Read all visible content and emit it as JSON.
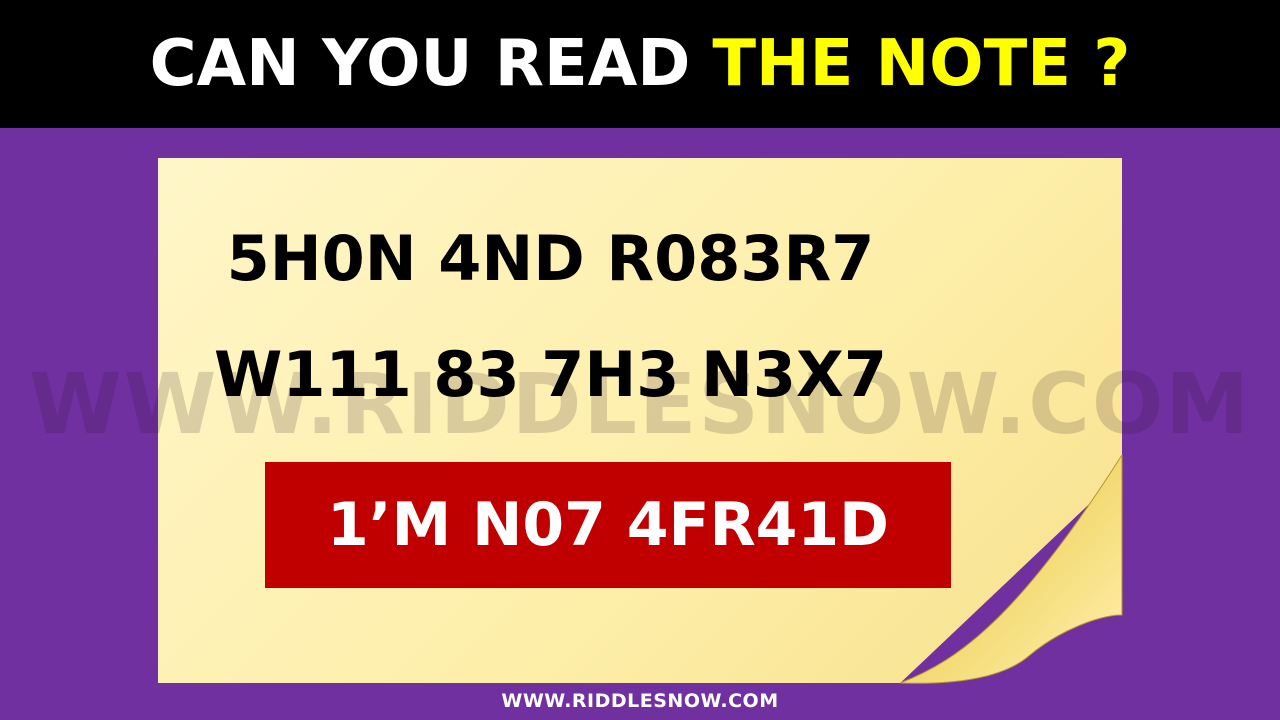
{
  "header": {
    "title_white": "CAN YOU READ",
    "title_yellow": "THE NOTE ?"
  },
  "note": {
    "line1": "5H0N 4ND R083R7",
    "line2": "W111 83 7H3 N3X7",
    "highlight": "1’M N07 4FR41D"
  },
  "watermark": "WWW.RIDDLESNOW.COM",
  "footer": "WWW.RIDDLESNOW.COM",
  "colors": {
    "background": "#7030a0",
    "header": "#000000",
    "title_accent": "#ffff00",
    "note_paper": "#fdf1b4",
    "banner": "#c00000"
  }
}
